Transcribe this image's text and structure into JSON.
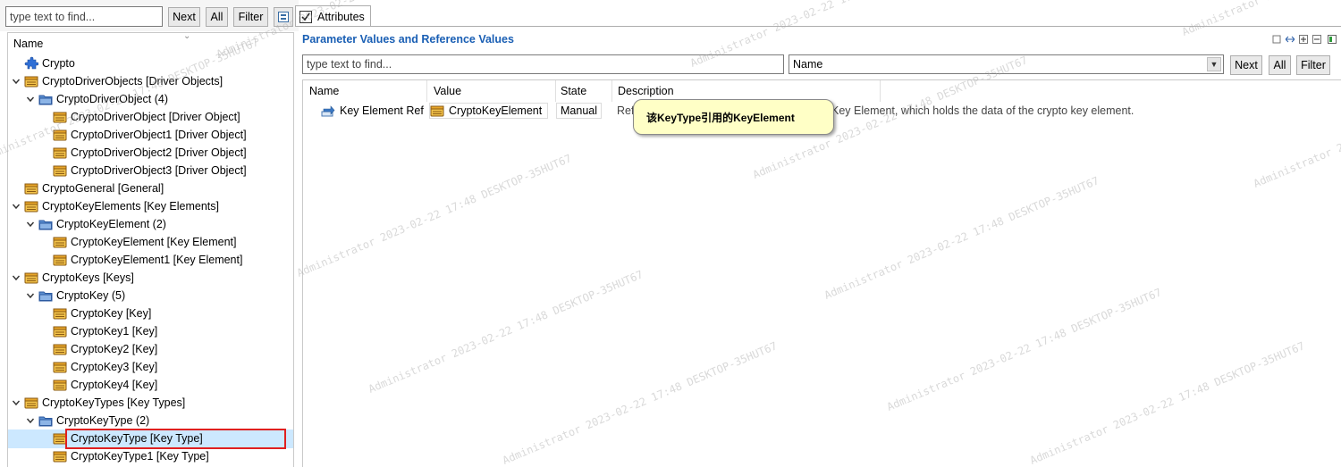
{
  "left_toolbar": {
    "search_placeholder": "type text to find...",
    "next_label": "Next",
    "all_label": "All",
    "filter_label": "Filter"
  },
  "tree": {
    "column_header": "Name",
    "rows": [
      {
        "label": "Crypto",
        "icon": "puzzle-icon"
      },
      {
        "label": "CryptoDriverObjects  [Driver Objects]",
        "icon": "container-icon"
      },
      {
        "label": "CryptoDriverObject (4)",
        "icon": "folder-icon"
      },
      {
        "label": "CryptoDriverObject  [Driver Object]",
        "icon": "container-icon"
      },
      {
        "label": "CryptoDriverObject1  [Driver Object]",
        "icon": "container-icon"
      },
      {
        "label": "CryptoDriverObject2  [Driver Object]",
        "icon": "container-icon"
      },
      {
        "label": "CryptoDriverObject3  [Driver Object]",
        "icon": "container-icon"
      },
      {
        "label": "CryptoGeneral  [General]",
        "icon": "container-icon"
      },
      {
        "label": "CryptoKeyElements  [Key Elements]",
        "icon": "container-icon"
      },
      {
        "label": "CryptoKeyElement (2)",
        "icon": "folder-icon"
      },
      {
        "label": "CryptoKeyElement  [Key Element]",
        "icon": "container-icon"
      },
      {
        "label": "CryptoKeyElement1  [Key Element]",
        "icon": "container-icon"
      },
      {
        "label": "CryptoKeys  [Keys]",
        "icon": "container-icon"
      },
      {
        "label": "CryptoKey (5)",
        "icon": "folder-icon"
      },
      {
        "label": "CryptoKey  [Key]",
        "icon": "container-icon"
      },
      {
        "label": "CryptoKey1  [Key]",
        "icon": "container-icon"
      },
      {
        "label": "CryptoKey2  [Key]",
        "icon": "container-icon"
      },
      {
        "label": "CryptoKey3  [Key]",
        "icon": "container-icon"
      },
      {
        "label": "CryptoKey4  [Key]",
        "icon": "container-icon"
      },
      {
        "label": "CryptoKeyTypes  [Key Types]",
        "icon": "container-icon"
      },
      {
        "label": "CryptoKeyType (2)",
        "icon": "folder-icon"
      },
      {
        "label": "CryptoKeyType  [Key Type]",
        "icon": "container-icon",
        "selected": true
      },
      {
        "label": "CryptoKeyType1  [Key Type]",
        "icon": "container-icon"
      }
    ]
  },
  "tab": {
    "label": "Attributes",
    "checked": true
  },
  "panel": {
    "title": "Parameter Values and Reference Values",
    "search_placeholder": "type text to find...",
    "select_value": "Name",
    "next_label": "Next",
    "all_label": "All",
    "filter_label": "Filter"
  },
  "grid": {
    "columns": [
      "Name",
      "Value",
      "State",
      "Description"
    ],
    "rows": [
      {
        "name": "Key Element Ref",
        "value": "CryptoKeyElement",
        "state": "Manual",
        "description_start": "Ref",
        "description_end": "Key Element, which holds the data of the crypto key element."
      }
    ]
  },
  "tooltip": {
    "text": "该KeyType引用的KeyElement"
  },
  "watermark": {
    "text": "Administrator 2023-02-22 17:48 DESKTOP-35HUT67"
  },
  "colors": {
    "title_blue": "#1a5fb4",
    "selection": "#cce8ff",
    "highlight_box": "#e02020",
    "tooltip_bg": "#ffffc6"
  }
}
